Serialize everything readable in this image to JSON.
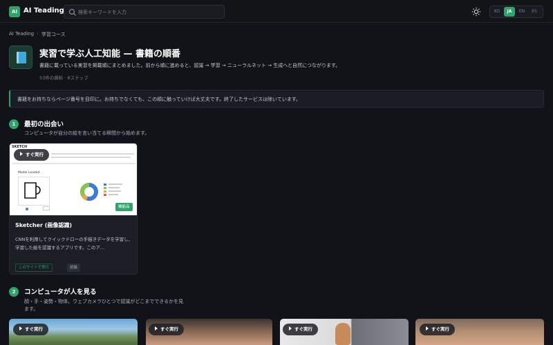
{
  "header": {
    "logo_mark": "AI",
    "brand": "AI Teading",
    "search_placeholder": "検索キーワードを入力",
    "languages": [
      "KO",
      "JA",
      "EN",
      "ES"
    ],
    "active_language": "JA"
  },
  "breadcrumb": [
    "AI Teading",
    "学習コース"
  ],
  "page": {
    "title": "実習で学ぶ人工知能 — 書籍の順番",
    "description": "書籍に載っている実習を掲載順にまとめました。前から順に進めると、認識 → 学習 → ニューラルネット → 生成へと自然につながります。",
    "meta": "53件の資料 · 8ステップ"
  },
  "notice": "書籍をお持ちならページ番号を目印に。お持ちでなくても、この順に触っていけば大丈夫です。終了したサービスは除いています。",
  "sections": [
    {
      "number": "1",
      "title": "最初の出会い",
      "subtitle": "コンピュータが自分の絵を言い当てる瞬間から始めます。",
      "cards": [
        {
          "badge": "すぐ実行",
          "corner_tag": "機能品",
          "title": "Sketcher (画像認識)",
          "description": "CNNを利用してクイックドローの手描きデータを学習し、学習した絵を認識するアプリです。このア…",
          "link": "このサイトで実行",
          "tag": "初級",
          "screenshot": {
            "heading": "SKETCH",
            "panel_label": "Model Loaded"
          }
        }
      ]
    },
    {
      "number": "2",
      "title": "コンピュータが人を見る",
      "subtitle_line1": "顔・手・姿勢・物体。ウェブカメラひとつで認識がどこまでできるかを見",
      "subtitle_line2": "ます。",
      "badge": "すぐ実行"
    }
  ],
  "colors": {
    "accent": "#2fa46a",
    "background": "#111318",
    "card": "#1b1e24"
  }
}
